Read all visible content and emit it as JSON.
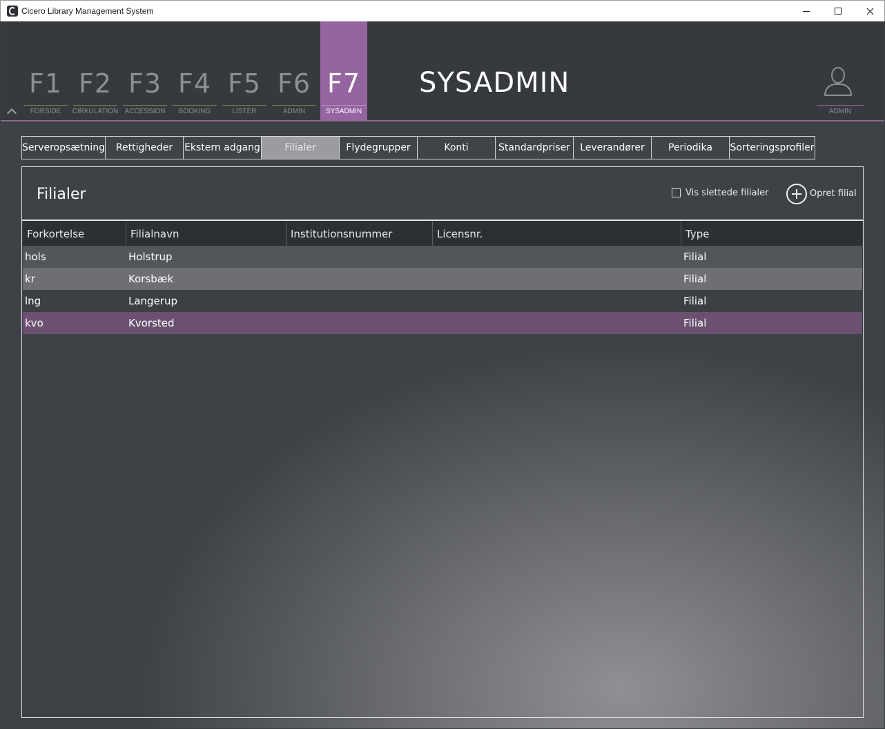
{
  "window": {
    "title": "Cicero Library Management System"
  },
  "header": {
    "fkeys": [
      {
        "key": "F1",
        "label": "FORSIDE"
      },
      {
        "key": "F2",
        "label": "CIRKULATION"
      },
      {
        "key": "F3",
        "label": "ACCESSION"
      },
      {
        "key": "F4",
        "label": "BOOKING"
      },
      {
        "key": "F5",
        "label": "LISTER"
      },
      {
        "key": "F6",
        "label": "ADMIN"
      },
      {
        "key": "F7",
        "label": "SYSADMIN"
      }
    ],
    "active_key": "F7",
    "module_title": "SYSADMIN",
    "user_label": "ADMIN",
    "accent_color": "#9565a1"
  },
  "tabs": [
    "Serveropsætning",
    "Rettigheder",
    "Ekstern adgang",
    "Filialer",
    "Flydegrupper",
    "Konti",
    "Standardpriser",
    "Leverandører",
    "Periodika",
    "Sorteringsprofiler"
  ],
  "active_tab": "Filialer",
  "panel": {
    "title": "Filialer",
    "show_deleted_label": "Vis slettede filialer",
    "show_deleted_checked": false,
    "create_label": "Opret filial"
  },
  "table": {
    "columns": [
      "Forkortelse",
      "Filialnavn",
      "Institutionsnummer",
      "Licensnr.",
      "Type"
    ],
    "rows": [
      {
        "abbr": "hols",
        "name": "Holstrup",
        "inst": "",
        "license": "",
        "type": "Filial"
      },
      {
        "abbr": "kr",
        "name": "Korsbæk",
        "inst": "",
        "license": "",
        "type": "Filial"
      },
      {
        "abbr": "lng",
        "name": "Langerup",
        "inst": "",
        "license": "",
        "type": "Filial"
      },
      {
        "abbr": "kvo",
        "name": "Kvorsted",
        "inst": "",
        "license": "",
        "type": "Filial"
      }
    ],
    "selected_row": 3
  }
}
